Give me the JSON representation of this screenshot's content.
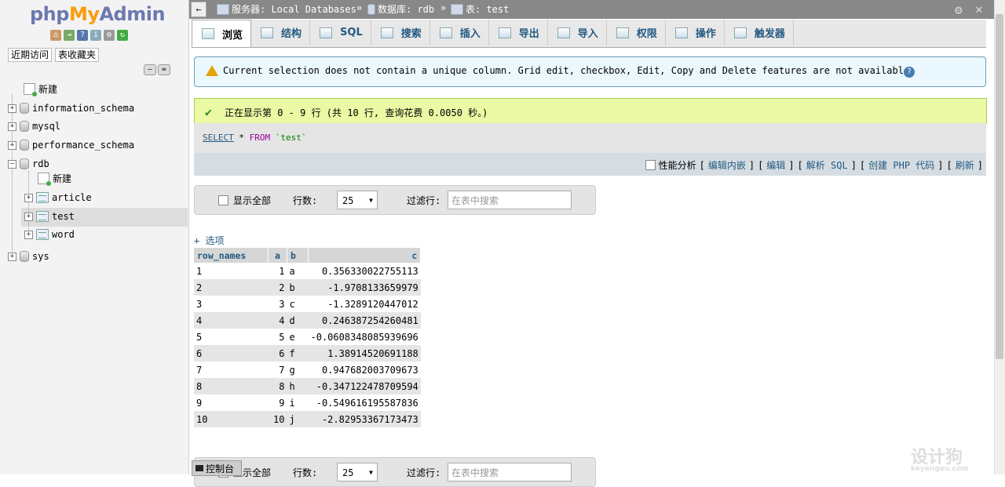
{
  "nav": {
    "logo": {
      "php": "php",
      "my": "My",
      "admin": "Admin"
    },
    "tabs": [
      "近期访问",
      "表收藏夹"
    ],
    "tree": {
      "new": "新建",
      "databases": [
        {
          "name": "information_schema"
        },
        {
          "name": "mysql"
        },
        {
          "name": "performance_schema"
        },
        {
          "name": "rdb",
          "expanded": true,
          "children": [
            {
              "name": "新建",
              "kind": "new"
            },
            {
              "name": "article",
              "kind": "table"
            },
            {
              "name": "test",
              "kind": "table",
              "selected": true
            },
            {
              "name": "word",
              "kind": "table"
            }
          ]
        },
        {
          "name": "sys"
        }
      ]
    }
  },
  "breadcrumb": {
    "server": "服务器: Local Databases",
    "database": "数据库: rdb",
    "table": "表: test",
    "sep": "»"
  },
  "tabs": [
    {
      "label": "浏览",
      "icon": "browse-icon",
      "active": true
    },
    {
      "label": "结构",
      "icon": "structure-icon"
    },
    {
      "label": "SQL",
      "icon": "sql-icon"
    },
    {
      "label": "搜索",
      "icon": "search-icon"
    },
    {
      "label": "插入",
      "icon": "insert-icon"
    },
    {
      "label": "导出",
      "icon": "export-icon"
    },
    {
      "label": "导入",
      "icon": "import-icon"
    },
    {
      "label": "权限",
      "icon": "privileges-icon"
    },
    {
      "label": "操作",
      "icon": "operations-icon"
    },
    {
      "label": "触发器",
      "icon": "triggers-icon"
    }
  ],
  "notice": "Current selection does not contain a unique column. Grid edit, checkbox, Edit, Copy and Delete features are not available.",
  "success": "正在显示第 0 - 9 行 (共 10 行, 查询花费 0.0050 秒。)",
  "sql": {
    "select": "SELECT",
    "star": "*",
    "from": "FROM",
    "table": "`test`"
  },
  "sql_ops": {
    "profiling": "性能分析",
    "links": [
      "编辑内嵌",
      "编辑",
      "解析 SQL",
      "创建 PHP 代码",
      "刷新"
    ]
  },
  "navbar": {
    "show_all": "显示全部",
    "rows_label": "行数:",
    "rows_value": "25",
    "filter_label": "过滤行:",
    "filter_placeholder": "在表中搜索"
  },
  "options_link": "+ 选项",
  "table": {
    "columns": [
      "row_names",
      "a",
      "b",
      "c"
    ],
    "rows": [
      [
        "1",
        "1",
        "a",
        "0.356330022755113"
      ],
      [
        "2",
        "2",
        "b",
        "-1.9708133659979"
      ],
      [
        "3",
        "3",
        "c",
        "-1.3289120447012"
      ],
      [
        "4",
        "4",
        "d",
        "0.246387254260481"
      ],
      [
        "5",
        "5",
        "e",
        "-0.0608348085939696"
      ],
      [
        "6",
        "6",
        "f",
        "1.38914520691188"
      ],
      [
        "7",
        "7",
        "g",
        "0.947682003709673"
      ],
      [
        "8",
        "8",
        "h",
        "-0.347122478709594"
      ],
      [
        "9",
        "9",
        "i",
        "-0.549616195587836"
      ],
      [
        "10",
        "10",
        "j",
        "-2.82953367173473"
      ]
    ]
  },
  "console": "控制台",
  "watermark": {
    "text": "设计狗",
    "sub": "keyangou.com"
  }
}
